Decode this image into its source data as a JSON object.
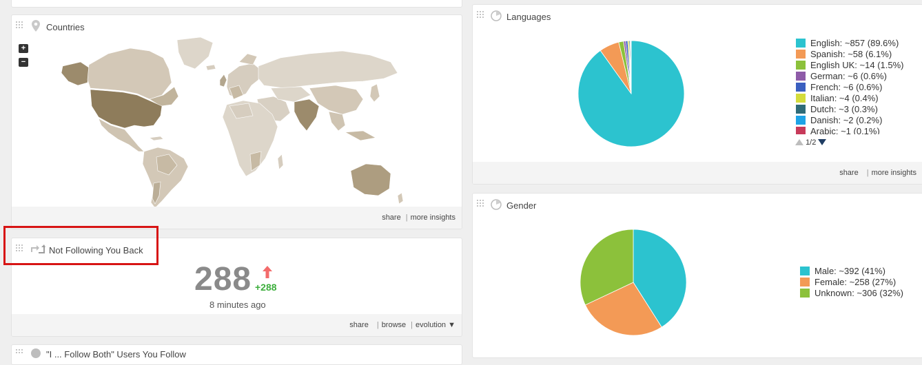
{
  "countries": {
    "title": "Countries",
    "zoom_in": "+",
    "zoom_out": "−",
    "footer": {
      "share": "share",
      "more_insights": "more insights",
      "separator": "|"
    }
  },
  "not_following": {
    "title": "Not Following You Back",
    "value": "288",
    "delta": "+288",
    "updated": "8 minutes ago",
    "footer": {
      "share": "share",
      "browse": "browse",
      "evolution": "evolution ▼",
      "separator": "|"
    }
  },
  "bottom_widget": {
    "title": "\"I ... Follow Both\" Users You Follow"
  },
  "languages": {
    "title": "Languages",
    "items": [
      {
        "label": "English: ~857 (89.6%)",
        "value": 857,
        "color": "#2cc3cf"
      },
      {
        "label": "Spanish: ~58 (6.1%)",
        "value": 58,
        "color": "#f39a56"
      },
      {
        "label": "English UK: ~14 (1.5%)",
        "value": 14,
        "color": "#8cc13b"
      },
      {
        "label": "German: ~6 (0.6%)",
        "value": 6,
        "color": "#8e5ba8"
      },
      {
        "label": "French: ~6 (0.6%)",
        "value": 6,
        "color": "#3a5fc0"
      },
      {
        "label": "Italian: ~4 (0.4%)",
        "value": 4,
        "color": "#d4dc3c"
      },
      {
        "label": "Dutch: ~3 (0.3%)",
        "value": 3,
        "color": "#2f6b78"
      },
      {
        "label": "Danish: ~2 (0.2%)",
        "value": 2,
        "color": "#1ea3e6"
      },
      {
        "label": "Arabic: ~1 (0.1%)",
        "value": 1,
        "color": "#c73a5a"
      }
    ],
    "pager": "1/2",
    "footer": {
      "share": "share",
      "more_insights": "more insights",
      "separator": "|"
    }
  },
  "gender": {
    "title": "Gender",
    "items": [
      {
        "label": "Male: ~392 (41%)",
        "value": 392,
        "color": "#2cc3cf"
      },
      {
        "label": "Female: ~258 (27%)",
        "value": 258,
        "color": "#f39a56"
      },
      {
        "label": "Unknown: ~306 (32%)",
        "value": 306,
        "color": "#8cc13b"
      }
    ]
  }
}
